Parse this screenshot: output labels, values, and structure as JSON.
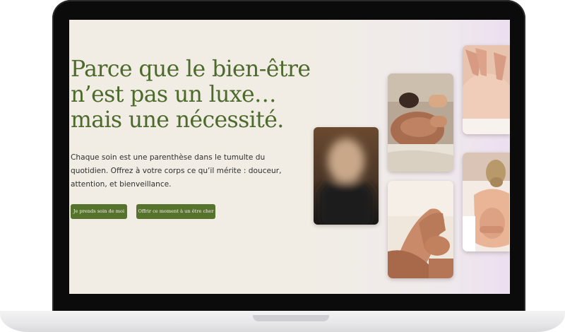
{
  "hero": {
    "headline_lines": [
      "Parce que le bien-être",
      "n’est pas un luxe…",
      "mais une nécessité."
    ],
    "subtext_lines": [
      "Chaque soin est une parenthèse dans le tumulte du",
      "quotidien. Offrez à votre corps ce qu’il mérite : douceur,",
      "attention, et bienveillance."
    ],
    "primary_button": "Je prends soin de moi",
    "secondary_button": "Offrir ce moment à un être cher"
  },
  "gallery": {
    "images": [
      "portrait-photo",
      "back-massage-photo",
      "foot-massage-photo",
      "shoulder-massage-photo",
      "back-massage-woman-photo"
    ]
  },
  "colors": {
    "accent": "#56732d",
    "headline": "#4c6a2b",
    "background": "#f1ede4"
  }
}
